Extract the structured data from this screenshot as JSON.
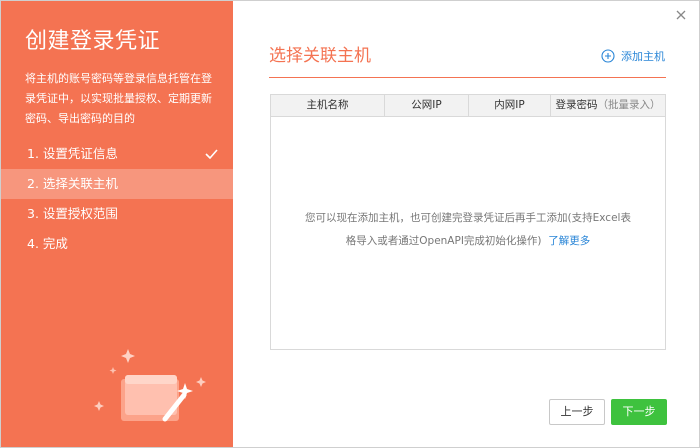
{
  "sidebar": {
    "title": "创建登录凭证",
    "description": "将主机的账号密码等登录信息托管在登录凭证中，以实现批量授权、定期更新密码、导出密码的目的",
    "steps": [
      {
        "label": "1. 设置凭证信息",
        "completed": true
      },
      {
        "label": "2. 选择关联主机",
        "active": true
      },
      {
        "label": "3. 设置授权范围"
      },
      {
        "label": "4. 完成"
      }
    ],
    "accent_color": "#f47352"
  },
  "main": {
    "section_title": "选择关联主机",
    "add_host_label": "添加主机",
    "table": {
      "columns": [
        "主机名称",
        "公网IP",
        "内网IP",
        "登录密码"
      ],
      "password_hint": "（批量录入）"
    },
    "empty_line1": "您可以现在添加主机，也可创建完登录凭证后再手工添加(支持Excel表",
    "empty_line2": "格导入或者通过OpenAPI完成初始化操作)",
    "learn_more": "了解更多"
  },
  "footer": {
    "prev_label": "上一步",
    "next_label": "下一步"
  },
  "icons": {
    "close": "close-icon",
    "add": "plus-circle-icon",
    "check": "check-icon",
    "illustration": "magic-wand-card-icon"
  }
}
